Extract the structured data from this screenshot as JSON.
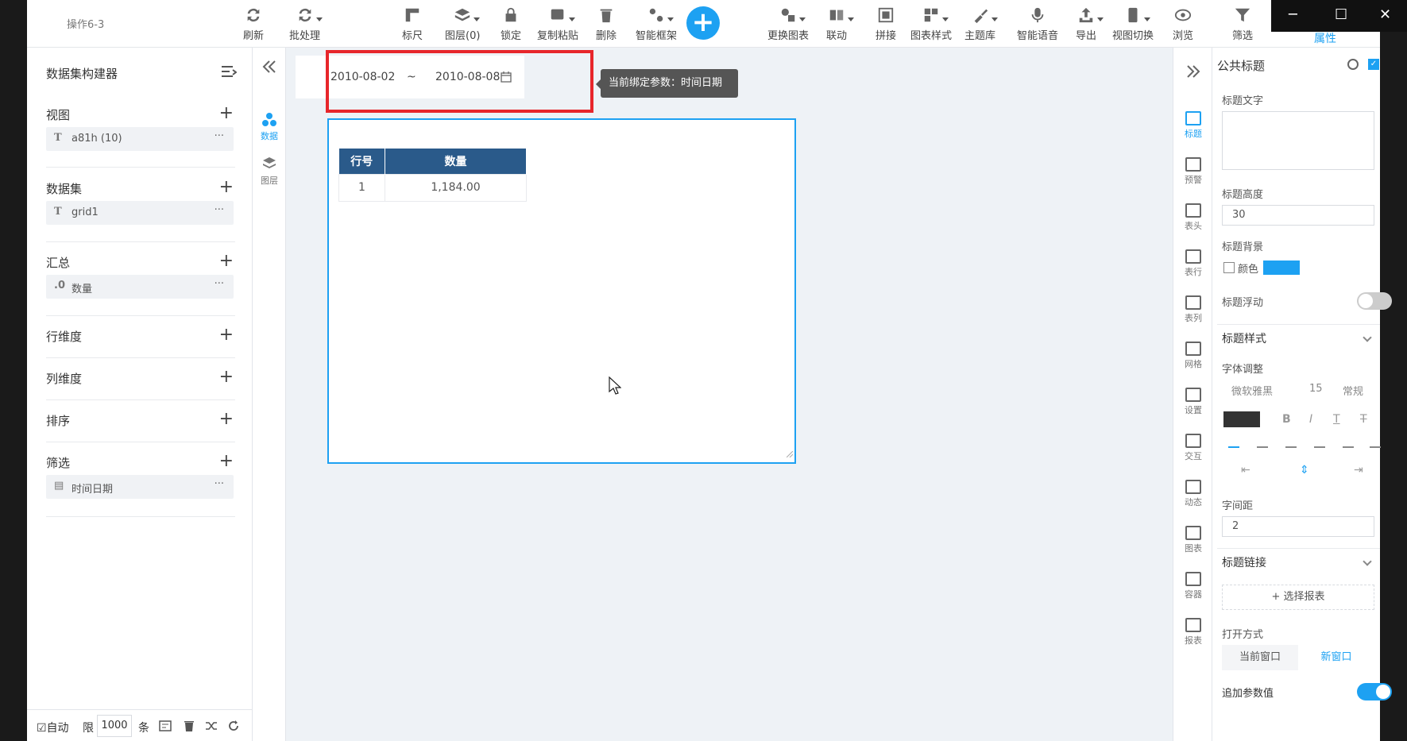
{
  "window": {
    "tab_title": "操作6-3",
    "min": "─",
    "max": "☐",
    "close": "✕"
  },
  "toolbar": {
    "items": [
      {
        "label": "刷新",
        "icon": "refresh-icon"
      },
      {
        "label": "批处理",
        "icon": "batch-icon"
      },
      {
        "label": "标尺",
        "icon": "ruler-icon"
      },
      {
        "label": "图层(0)",
        "icon": "layers-icon"
      },
      {
        "label": "锁定",
        "icon": "lock-icon"
      },
      {
        "label": "复制粘贴",
        "icon": "copy-paste-icon"
      },
      {
        "label": "删除",
        "icon": "trash-icon"
      },
      {
        "label": "智能框架",
        "icon": "smart-frame-icon"
      },
      {
        "label": "更换图表",
        "icon": "change-chart-icon"
      },
      {
        "label": "联动",
        "icon": "link-icon"
      },
      {
        "label": "拼接",
        "icon": "splice-icon"
      },
      {
        "label": "图表样式",
        "icon": "chart-style-icon"
      },
      {
        "label": "主题库",
        "icon": "theme-icon"
      },
      {
        "label": "智能语音",
        "icon": "microphone-icon"
      },
      {
        "label": "导出",
        "icon": "export-icon"
      },
      {
        "label": "视图切换",
        "icon": "view-switch-icon"
      },
      {
        "label": "浏览",
        "icon": "eye-icon"
      },
      {
        "label": "筛选",
        "icon": "filter-icon"
      }
    ],
    "add": "+",
    "properties_tab": "属性"
  },
  "left": {
    "title": "数据集构建器",
    "sections": {
      "view": {
        "title": "视图",
        "chip": {
          "type": "T",
          "label": "a81h (10)"
        }
      },
      "dataset": {
        "title": "数据集",
        "chip": {
          "type": "T",
          "label": "grid1"
        }
      },
      "summary": {
        "title": "汇总",
        "chip": {
          "type": ".0",
          "label": "数量"
        }
      },
      "row_dim": {
        "title": "行维度"
      },
      "col_dim": {
        "title": "列维度"
      },
      "sort": {
        "title": "排序"
      },
      "filter": {
        "title": "筛选",
        "chip": {
          "type": "▤",
          "label": "时间日期"
        }
      }
    },
    "plus": "+",
    "more": "···",
    "footer": {
      "auto": "☑自动",
      "limit": "限",
      "limit_value": "1000",
      "unit": "条"
    }
  },
  "strip": {
    "data": "数据",
    "layers": "图层"
  },
  "canvas": {
    "date_from": "2010-08-02",
    "tilde": "~",
    "date_to": "2010-08-08",
    "tooltip": "当前绑定参数：时间日期",
    "table": {
      "headers": [
        "行号",
        "数量"
      ],
      "rows": [
        [
          "1",
          "1,184.00"
        ]
      ]
    }
  },
  "rstrip": [
    "标题",
    "预警",
    "表头",
    "表行",
    "表列",
    "网格",
    "设置",
    "交互",
    "动态",
    "图表",
    "容器",
    "报表"
  ],
  "props": {
    "header": "公共标题",
    "title_text_label": "标题文字",
    "title_height_label": "标题高度",
    "title_height_value": "30",
    "title_bg_label": "标题背景",
    "color_label": "颜色",
    "title_float_label": "标题浮动",
    "title_style_label": "标题样式",
    "font_adjust_label": "字体调整",
    "font_name": "微软雅黑",
    "font_size": "15",
    "font_weight": "常规",
    "letter_spacing_label": "字间距",
    "letter_spacing_value": "2",
    "title_link_label": "标题链接",
    "select_report": "+ 选择报表",
    "open_mode_label": "打开方式",
    "current_window": "当前窗口",
    "new_window": "新窗口",
    "append_param_label": "追加参数值",
    "colors": {
      "accent": "#1da1f2",
      "header_blue": "#2a5a8a",
      "highlight_red": "#e7262b"
    }
  }
}
